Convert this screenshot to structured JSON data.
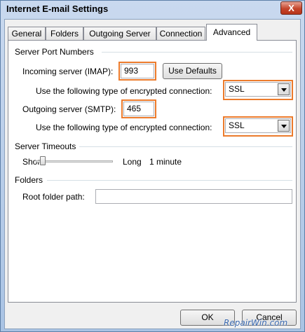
{
  "window": {
    "title": "Internet E-mail Settings",
    "close_glyph": "X"
  },
  "tabs": [
    {
      "label": "General"
    },
    {
      "label": "Folders"
    },
    {
      "label": "Outgoing Server"
    },
    {
      "label": "Connection"
    },
    {
      "label": "Advanced",
      "active": true
    }
  ],
  "ports": {
    "group_label": "Server Port Numbers",
    "incoming_label": "Incoming server (IMAP):",
    "incoming_value": "993",
    "use_defaults_label": "Use Defaults",
    "encrypt_label": "Use the following type of encrypted connection:",
    "incoming_encryption": "SSL",
    "outgoing_label": "Outgoing server (SMTP):",
    "outgoing_value": "465",
    "outgoing_encryption": "SSL"
  },
  "timeouts": {
    "group_label": "Server Timeouts",
    "short_label": "Short",
    "long_label": "Long",
    "value_text": "1 minute",
    "slider_level": 0.1
  },
  "folders": {
    "group_label": "Folders",
    "root_label": "Root folder path:",
    "root_value": ""
  },
  "footer": {
    "ok_label": "OK",
    "cancel_label": "Cancel"
  },
  "watermark": "RepairWin.com",
  "colors": {
    "highlight": "#ec7b2c"
  }
}
